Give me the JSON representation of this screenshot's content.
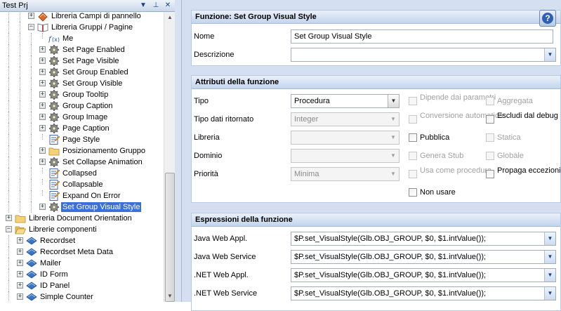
{
  "tree_panel": {
    "title": "Test Prj",
    "controls": {
      "dropdown": "▼",
      "pin": "⊥",
      "close": "✕"
    },
    "items": [
      {
        "label": "Libreria Campi di pannello",
        "icon": "library-fields-icon",
        "level": 3,
        "expander": "plus"
      },
      {
        "label": "Libreria Gruppi / Pagine",
        "icon": "book-icon",
        "level": 3,
        "expander": "minus"
      },
      {
        "label": "Me",
        "icon": "function-icon",
        "level": 4,
        "expander": "none"
      },
      {
        "label": "Set Page Enabled",
        "icon": "gear-icon",
        "level": 4,
        "expander": "plus"
      },
      {
        "label": "Set Page Visible",
        "icon": "gear-icon",
        "level": 4,
        "expander": "plus"
      },
      {
        "label": "Set Group Enabled",
        "icon": "gear-icon",
        "level": 4,
        "expander": "plus"
      },
      {
        "label": "Set Group Visible",
        "icon": "gear-icon",
        "level": 4,
        "expander": "plus"
      },
      {
        "label": "Group Tooltip",
        "icon": "gear-icon",
        "level": 4,
        "expander": "plus"
      },
      {
        "label": "Group Caption",
        "icon": "gear-icon",
        "level": 4,
        "expander": "plus"
      },
      {
        "label": "Group Image",
        "icon": "gear-icon",
        "level": 4,
        "expander": "plus"
      },
      {
        "label": "Page Caption",
        "icon": "gear-icon",
        "level": 4,
        "expander": "plus"
      },
      {
        "label": "Page Style",
        "icon": "property-icon",
        "level": 4,
        "expander": "none"
      },
      {
        "label": "Posizionamento Gruppo",
        "icon": "folder-icon",
        "level": 4,
        "expander": "plus"
      },
      {
        "label": "Set Collapse Animation",
        "icon": "gear-icon",
        "level": 4,
        "expander": "plus"
      },
      {
        "label": "Collapsed",
        "icon": "property-icon",
        "level": 4,
        "expander": "none"
      },
      {
        "label": "Collapsable",
        "icon": "property-icon",
        "level": 4,
        "expander": "none"
      },
      {
        "label": "Expand On Error",
        "icon": "property-icon",
        "level": 4,
        "expander": "none"
      },
      {
        "label": "Set Group Visual Style",
        "icon": "gear-icon",
        "level": 4,
        "expander": "plus",
        "selected": true
      },
      {
        "label": "Libreria Document Orientation",
        "icon": "folder-icon",
        "level": 1,
        "expander": "plus"
      },
      {
        "label": "Librerie componenti",
        "icon": "folder-open-icon",
        "level": 1,
        "expander": "minus"
      },
      {
        "label": "Recordset",
        "icon": "component-icon",
        "level": 2,
        "expander": "plus"
      },
      {
        "label": "Recordset Meta Data",
        "icon": "component-icon",
        "level": 2,
        "expander": "plus"
      },
      {
        "label": "Mailer",
        "icon": "component-icon",
        "level": 2,
        "expander": "plus"
      },
      {
        "label": "ID Form",
        "icon": "component-icon",
        "level": 2,
        "expander": "plus"
      },
      {
        "label": "ID Panel",
        "icon": "component-icon",
        "level": 2,
        "expander": "plus"
      },
      {
        "label": "Simple Counter",
        "icon": "component-icon",
        "level": 2,
        "expander": "plus"
      }
    ]
  },
  "function_section": {
    "header": "Funzione: Set Group Visual Style",
    "help_label": "?",
    "name_label": "Nome",
    "name_value": "Set Group Visual Style",
    "description_label": "Descrizione",
    "description_value": ""
  },
  "attributes_section": {
    "header": "Attributi della funzione",
    "type_label": "Tipo",
    "type_value": "Procedura",
    "return_type_label": "Tipo dati ritornato",
    "return_type_value": "Integer",
    "library_label": "Libreria",
    "library_value": "",
    "domain_label": "Dominio",
    "domain_value": "",
    "priority_label": "Priorità",
    "priority_value": "Minima",
    "checkboxes_col1": [
      {
        "label": "Dipende dai parametri",
        "enabled": false,
        "checked": false
      },
      {
        "label": "Conversione automatica",
        "enabled": false,
        "checked": false
      },
      {
        "label": "Pubblica",
        "enabled": true,
        "checked": false
      },
      {
        "label": "Genera Stub",
        "enabled": false,
        "checked": false
      },
      {
        "label": "Usa come procedura",
        "enabled": false,
        "checked": false
      },
      {
        "label": "Non usare",
        "enabled": true,
        "checked": false
      }
    ],
    "checkboxes_col2": [
      {
        "label": "Aggregata",
        "enabled": false,
        "checked": false
      },
      {
        "label": "Escludi dal debug",
        "enabled": true,
        "checked": false
      },
      {
        "label": "Statica",
        "enabled": false,
        "checked": false
      },
      {
        "label": "Globale",
        "enabled": false,
        "checked": false
      },
      {
        "label": "Propaga eccezioni",
        "enabled": true,
        "checked": false
      }
    ]
  },
  "expressions_section": {
    "header": "Espressioni della funzione",
    "rows": [
      {
        "label": "Java Web Appl.",
        "value": "$P.set_VisualStyle(Glb.OBJ_GROUP, $0, $1.intValue());"
      },
      {
        "label": "Java Web Service",
        "value": "$P.set_VisualStyle(Glb.OBJ_GROUP, $0, $1.intValue());"
      },
      {
        "label": ".NET Web Appl.",
        "value": "$P.set_VisualStyle(Glb.OBJ_GROUP, $0, $1.intValue());"
      },
      {
        "label": ".NET Web Service",
        "value": "$P.set_VisualStyle(Glb.OBJ_GROUP, $0, $1.intValue());"
      }
    ]
  }
}
